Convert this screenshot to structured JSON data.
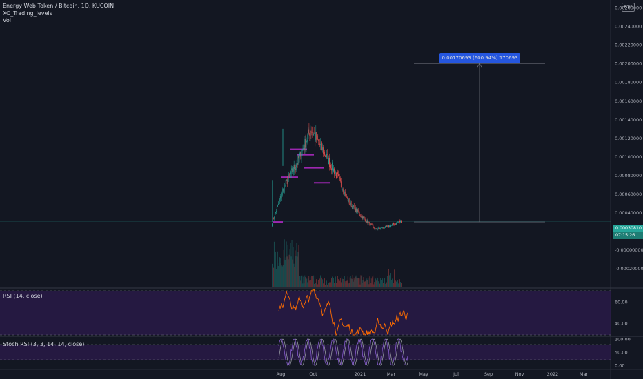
{
  "header": {
    "symbol_title": "Energy Web Token / Bitcoin, 1D, KUCOIN",
    "indicator_1": "XO_Trading_levels",
    "indicator_2": "Vol",
    "currency_badge": "BTC"
  },
  "price_axis": {
    "labels": [
      "0.00260000",
      "0.00240000",
      "0.00220000",
      "0.00200000",
      "0.00180000",
      "0.00160000",
      "0.00140000",
      "0.00120000",
      "0.00100000",
      "0.00080000",
      "0.00060000",
      "0.00040000",
      "0.00020000",
      "-0.00000000",
      "-0.00020000"
    ],
    "current_price": "0.00030810",
    "countdown": "07:15:26"
  },
  "time_axis": {
    "labels": [
      "Aug",
      "Oct",
      "2021",
      "Mar",
      "May",
      "Jul",
      "Sep",
      "Nov",
      "2022",
      "Mar"
    ]
  },
  "measure_tool": {
    "label": "0.00170693 (600.94%) 170693"
  },
  "rsi_pane": {
    "label": "RSI (14, close)",
    "levels": [
      "60.00",
      "40.00"
    ]
  },
  "stoch_pane": {
    "label": "Stoch RSI (3, 3, 14, 14, close)",
    "levels": [
      "100.00",
      "50.00",
      "0.00"
    ]
  },
  "colors": {
    "background": "#131722",
    "up": "#26a69a",
    "down": "#ef5350",
    "rsi_line": "#ff6d00",
    "rsi_fill": "#2a1a4a",
    "stoch_k": "#7e57c2",
    "stoch_d": "#9598a1",
    "measure": "#2962ff",
    "xo_level": "#9c27b0"
  },
  "chart_data": {
    "type": "candlestick",
    "title": "Energy Web Token / Bitcoin, 1D, KUCOIN",
    "y_unit": "BTC",
    "ylim": [
      -0.0003,
      0.0027
    ],
    "x_ticks": [
      "Aug",
      "Oct",
      "2021",
      "Mar",
      "May",
      "Jul",
      "Sep",
      "Nov",
      "2022",
      "Mar"
    ],
    "close_trend": [
      {
        "t": "Jul start",
        "v": 0.0003
      },
      {
        "t": "Jul",
        "v": 0.0007
      },
      {
        "t": "Aug",
        "v": 0.00095
      },
      {
        "t": "Aug peak",
        "v": 0.0013
      },
      {
        "t": "Sep",
        "v": 0.00105
      },
      {
        "t": "Oct",
        "v": 0.0008
      },
      {
        "t": "Nov",
        "v": 0.0005
      },
      {
        "t": "Dec",
        "v": 0.00035
      },
      {
        "t": "2021",
        "v": 0.00022
      },
      {
        "t": "Feb",
        "v": 0.00025
      },
      {
        "t": "Mar",
        "v": 0.00031
      }
    ],
    "current_price": 0.0003081,
    "measure": {
      "from": 0.0003,
      "to": 0.002,
      "change": 0.00170693,
      "percent": 600.94
    },
    "rsi_levels": [
      60,
      40
    ],
    "stoch_levels": [
      100,
      50,
      0
    ]
  }
}
